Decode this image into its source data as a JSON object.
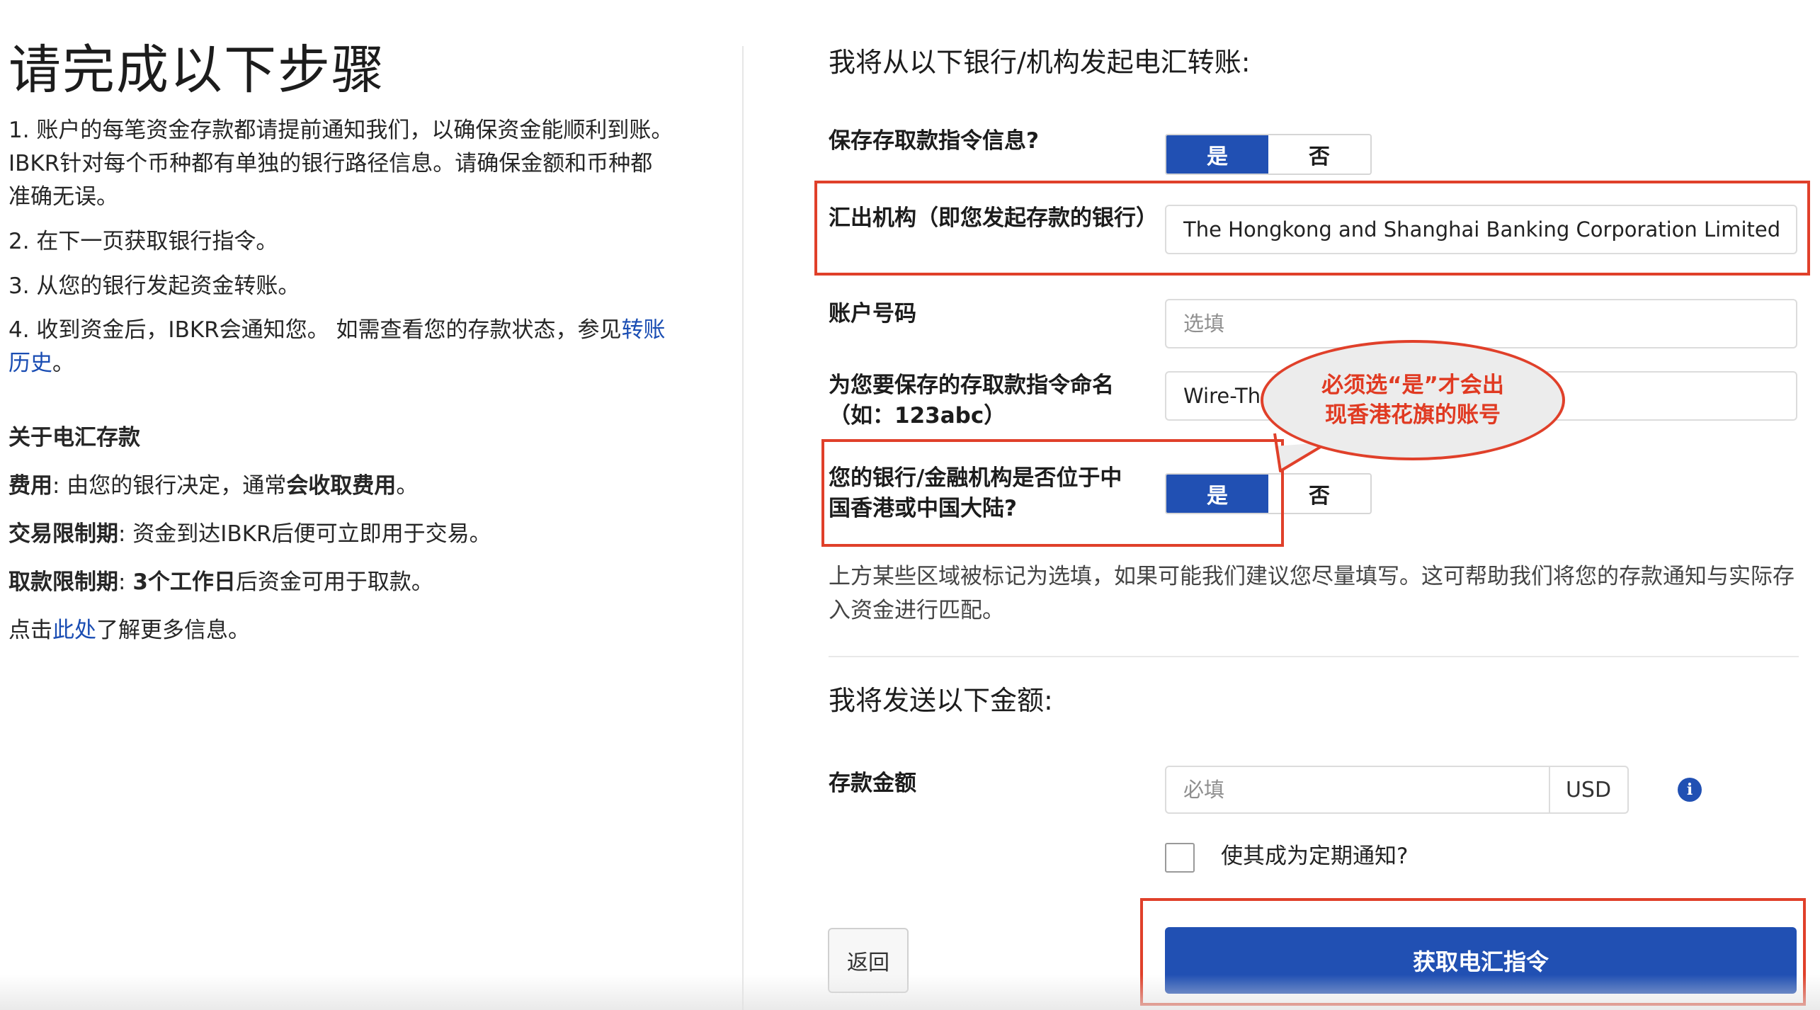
{
  "left": {
    "title": "请完成以下步骤",
    "step1": "1. 账户的每笔资金存款都请提前通知我们，以确保资金能顺利到账。IBKR针对每个币种都有单独的银行路径信息。请确保金额和币种都准确无误。",
    "step2": "2. 在下一页获取银行指令。",
    "step3": "3. 从您的银行发起资金转账。",
    "step4_prefix": "4. 收到资金后，IBKR会通知您。 如需查看您的存款状态，参见",
    "step4_link": "转账历史",
    "step4_suffix": "。",
    "about_heading": "关于电汇存款",
    "fee_label": "费用",
    "fee_text_a": ": 由您的银行决定，通常",
    "fee_text_b": "会收取费用",
    "fee_text_c": "。",
    "trade_label": "交易限制期",
    "trade_text": ": 资金到达IBKR后便可立即用于交易。",
    "withdraw_label": "取款限制期",
    "withdraw_text_a": ": ",
    "withdraw_text_b": "3个工作日",
    "withdraw_text_c": "后资金可用于取款。",
    "more_prefix": "点击",
    "more_link": "此处",
    "more_suffix": "了解更多信息。"
  },
  "right": {
    "heading_bank": "我将从以下银行/机构发起电汇转账:",
    "save_label": "保存存取款指令信息?",
    "save_yes": "是",
    "save_no": "否",
    "institution_label": "汇出机构（即您发起存款的银行）",
    "institution_value": "The Hongkong and Shanghai Banking Corporation Limited",
    "account_label": "账户号码",
    "account_placeholder": "选填",
    "name_label": "为您要保存的存取款指令命名（如：123abc）",
    "name_value": "Wire-The Ho",
    "hk_label": "您的银行/金融机构是否位于中国香港或中国大陆?",
    "hk_yes": "是",
    "hk_no": "否",
    "note": "上方某些区域被标记为选填，如果可能我们建议您尽量填写。这可帮助我们将您的存款通知与实际存入资金进行匹配。",
    "heading_amount": "我将发送以下金额:",
    "amount_label": "存款金额",
    "amount_placeholder": "必填",
    "currency": "USD",
    "info_icon": "i",
    "recurring_label": "使其成为定期通知?",
    "back_button": "返回",
    "submit_button": "获取电汇指令"
  },
  "annotation": {
    "callout_text": "必须选“是”才会出现香港花旗的账号",
    "color": "#e0402a"
  },
  "colors": {
    "primary": "#2150b3",
    "link": "#1a4db3"
  }
}
